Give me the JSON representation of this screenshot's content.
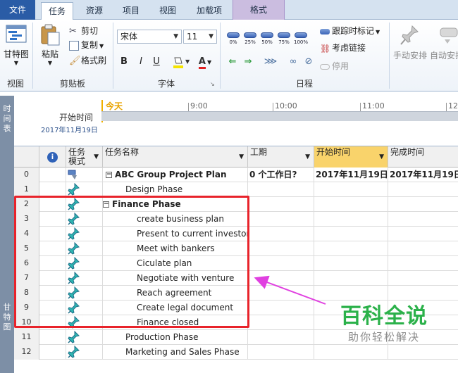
{
  "tabs": [
    "文件",
    "任务",
    "资源",
    "项目",
    "视图",
    "加载项",
    "格式"
  ],
  "ribbon": {
    "view": {
      "button": "甘特图",
      "group": "视图"
    },
    "clipboard": {
      "paste": "粘贴",
      "cut": "剪切",
      "copy": "复制",
      "painter": "格式刷",
      "group": "剪贴板"
    },
    "font": {
      "name": "宋体",
      "size": "11",
      "bold": "B",
      "italic": "I",
      "underline": "U",
      "font_color": "A",
      "group": "字体"
    },
    "schedule": {
      "percents": [
        "0%",
        "25%",
        "50%",
        "75%",
        "100%"
      ],
      "mark_on_track": "跟踪时标记",
      "respect_links": "考虑链接",
      "inactivate": "停用",
      "group": "日程"
    },
    "tasks": {
      "manual": "手动安排",
      "auto": "自动安排"
    }
  },
  "timeline": {
    "side_label": "时间表",
    "start_label": "开始时间",
    "start_date": "2017年11月19日",
    "today": "今天",
    "ticks": [
      "9:00",
      "10:00",
      "11:00",
      "12"
    ]
  },
  "grid": {
    "side_label": "甘特图",
    "headers": {
      "mode": "任务\n模式",
      "name": "任务名称",
      "duration": "工期",
      "start": "开始时间",
      "finish": "完成时间"
    },
    "rows": [
      {
        "id": "0",
        "name": "ABC Group Project Plan",
        "level": 0,
        "summary": true,
        "bold": true,
        "duration": "0 个工作日?",
        "start": "2017年11月19日",
        "finish": "2017年11月19日"
      },
      {
        "id": "1",
        "name": "Design Phase",
        "level": 1,
        "summary": false,
        "bold": false,
        "duration": "",
        "start": "",
        "finish": ""
      },
      {
        "id": "2",
        "name": "Finance Phase",
        "level": 1,
        "summary": true,
        "bold": true,
        "duration": "",
        "start": "",
        "finish": ""
      },
      {
        "id": "3",
        "name": "create business plan",
        "level": 2,
        "summary": false,
        "bold": false,
        "duration": "",
        "start": "",
        "finish": ""
      },
      {
        "id": "4",
        "name": "Present to current investor",
        "level": 2,
        "summary": false,
        "bold": false,
        "duration": "",
        "start": "",
        "finish": ""
      },
      {
        "id": "5",
        "name": "Meet with bankers",
        "level": 2,
        "summary": false,
        "bold": false,
        "duration": "",
        "start": "",
        "finish": ""
      },
      {
        "id": "6",
        "name": "Ciculate plan",
        "level": 2,
        "summary": false,
        "bold": false,
        "duration": "",
        "start": "",
        "finish": ""
      },
      {
        "id": "7",
        "name": "Negotiate with venture",
        "level": 2,
        "summary": false,
        "bold": false,
        "duration": "",
        "start": "",
        "finish": ""
      },
      {
        "id": "8",
        "name": "Reach agreement",
        "level": 2,
        "summary": false,
        "bold": false,
        "duration": "",
        "start": "",
        "finish": ""
      },
      {
        "id": "9",
        "name": "Create legal document",
        "level": 2,
        "summary": false,
        "bold": false,
        "duration": "",
        "start": "",
        "finish": ""
      },
      {
        "id": "10",
        "name": "Finance closed",
        "level": 2,
        "summary": false,
        "bold": false,
        "duration": "",
        "start": "",
        "finish": ""
      },
      {
        "id": "11",
        "name": "Production Phase",
        "level": 1,
        "summary": false,
        "bold": false,
        "duration": "",
        "start": "",
        "finish": ""
      },
      {
        "id": "12",
        "name": "Marketing and Sales Phase",
        "level": 1,
        "summary": false,
        "bold": false,
        "duration": "",
        "start": "",
        "finish": ""
      }
    ]
  },
  "watermark": {
    "title": "百科全说",
    "subtitle": "助你轻松解决"
  },
  "colors": {
    "accent_file": "#2a5ca6",
    "highlight_box": "#e8232b",
    "arrow": "#e040e0",
    "start_header": "#f9d36b",
    "watermark": "#2bb14a"
  }
}
